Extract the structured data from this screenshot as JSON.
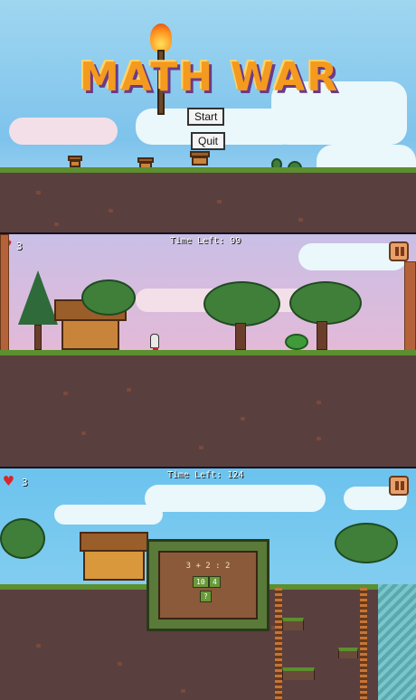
{
  "title_screen": {
    "game_title": "MATH WAR",
    "start_label": "Start",
    "quit_label": "Quit",
    "title_icon": "torch-icon"
  },
  "level_one": {
    "lives": "3",
    "time_left_label": "Time Left: 99",
    "pause_icon": "pause-icon"
  },
  "level_two": {
    "lives": "3",
    "time_left_label": "Time Left: 124",
    "pause_icon": "pause-icon",
    "question": {
      "expression": "3 + 2 : 2",
      "answers": [
        "10",
        "4"
      ],
      "unknown": "?"
    }
  },
  "colors": {
    "title": "#f39a1f",
    "grass": "#5c8f2f",
    "dirt": "#5a3f3f",
    "heart": "#d9262a",
    "board": "#5a7a3a"
  }
}
